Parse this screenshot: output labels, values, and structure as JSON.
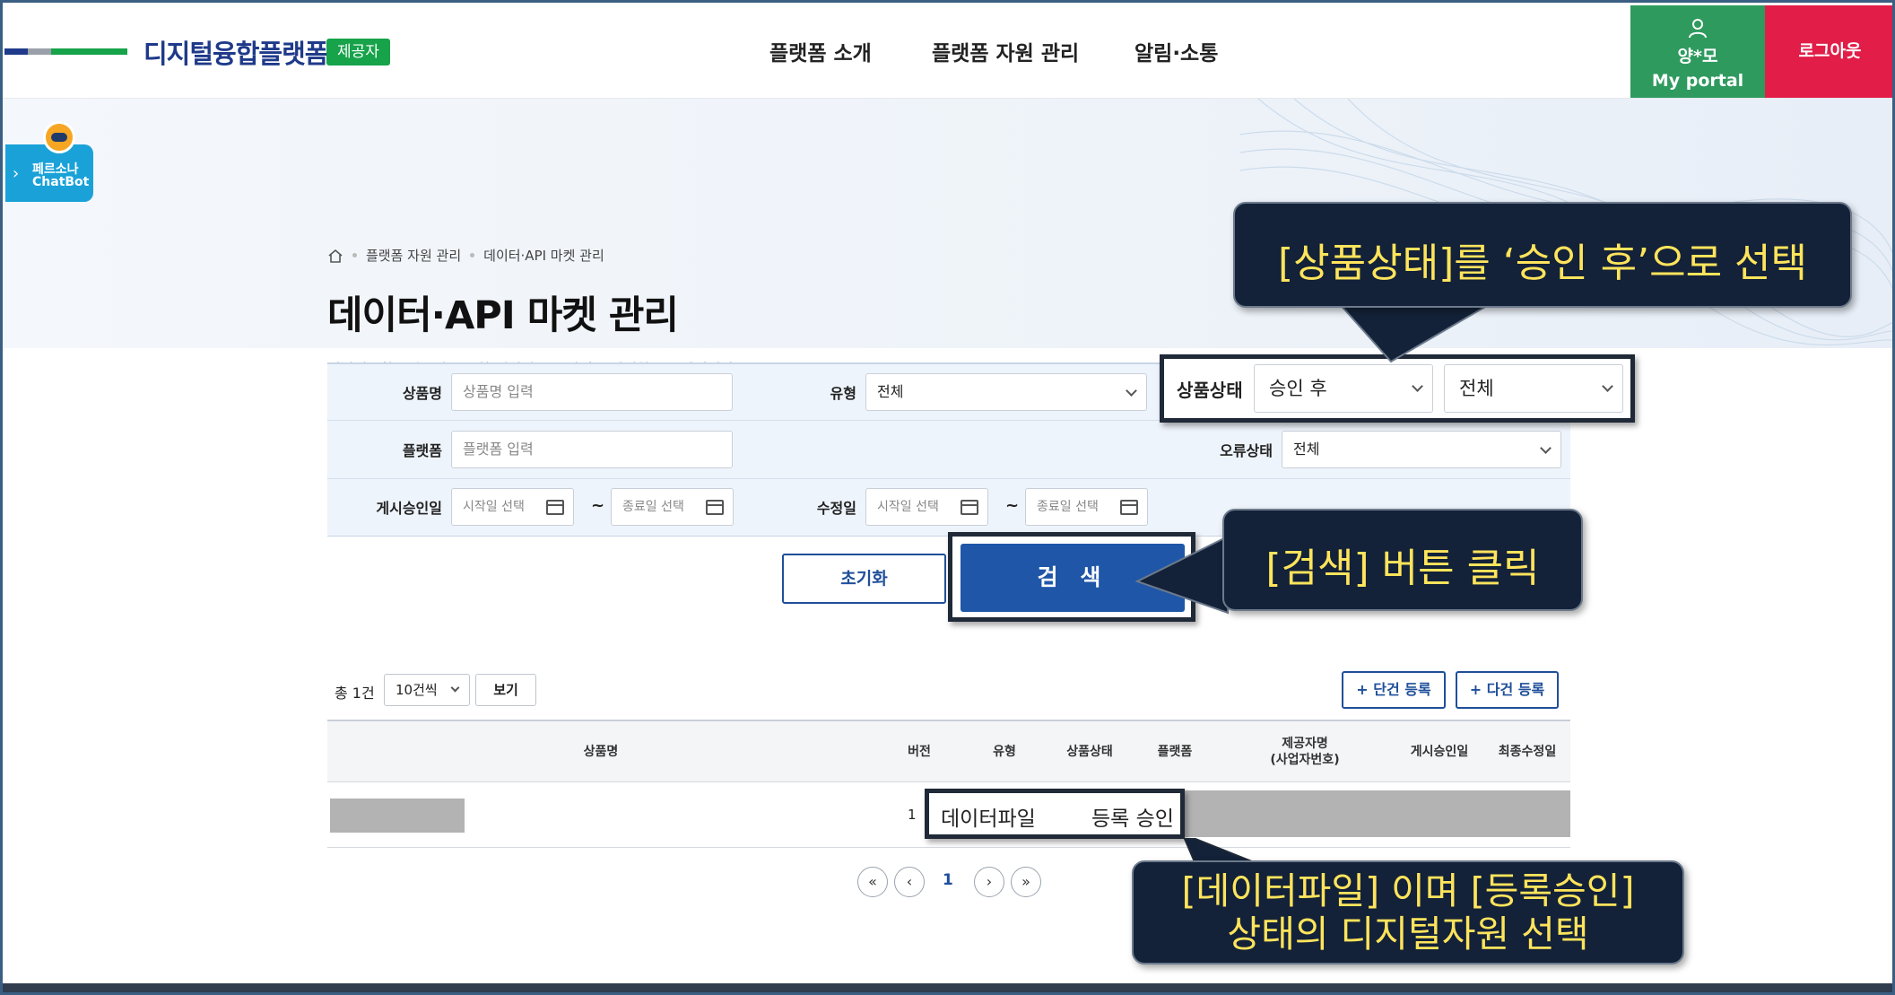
{
  "header": {
    "logo": "디지털융합플랫폼",
    "role_badge": "제공자",
    "nav": [
      "플랫폼 소개",
      "플랫폼 자원 관리",
      "알림·소통"
    ],
    "user_name": "양*모",
    "portal_label": "My portal",
    "logout_label": "로그아웃",
    "colors": {
      "portal": "#2e9a5e",
      "logout": "#e11d48",
      "brand": "#1f3a8a"
    }
  },
  "chatbot": {
    "line1": "페르소나",
    "line2": "ChatBot",
    "arrow": "›"
  },
  "breadcrumb": {
    "home_icon": "home-icon",
    "items": [
      "플랫폼 자원 관리",
      "데이터·API 마켓 관리"
    ]
  },
  "page": {
    "title": "데이터·API 마켓 관리",
    "description": "디지털융합플랫폼에 등록한 데이터·API 자원을 관리하는 공간입니다."
  },
  "form": {
    "product_name": {
      "label": "상품명",
      "placeholder": "상품명 입력"
    },
    "type": {
      "label": "유형",
      "value": "전체"
    },
    "product_status": {
      "label": "상품상태",
      "value1": "승인 후",
      "value2": "전체"
    },
    "platform": {
      "label": "플랫폼",
      "placeholder": "플랫폼 입력"
    },
    "error_status": {
      "label": "오류상태",
      "value": "전체"
    },
    "approval_date": {
      "label": "게시승인일",
      "start": "시작일 선택",
      "end": "종료일 선택"
    },
    "modified_date": {
      "label": "수정일",
      "start": "시작일 선택",
      "end": "종료일 선택"
    },
    "tilde": "~",
    "reset_label": "초기화",
    "search_label": "검 색"
  },
  "list": {
    "total": "총 1건",
    "per_page": "10건씩",
    "view_label": "보기",
    "single_reg": "+ 단건 등록",
    "multi_reg": "+ 다건 등록",
    "columns": [
      "상품명",
      "버전",
      "유형",
      "상품상태",
      "플랫폼",
      "제공자명\n(사업자번호)",
      "게시승인일",
      "최종수정일"
    ],
    "row": {
      "version": "1",
      "type": "데이터파일",
      "status": "등록 승인"
    }
  },
  "pagination": {
    "first": "«",
    "prev": "‹",
    "page": "1",
    "next": "›",
    "last": "»"
  },
  "callouts": {
    "status": "[상품상태]를 ‘승인 후’으로 선택",
    "search": "[검색] 버튼 클릭",
    "row_line1": "[데이터파일] 이며 [등록승인]",
    "row_line2": "상태의 디지털자원 선택",
    "text_color": "#ffe45c",
    "bg_color": "#132238"
  }
}
